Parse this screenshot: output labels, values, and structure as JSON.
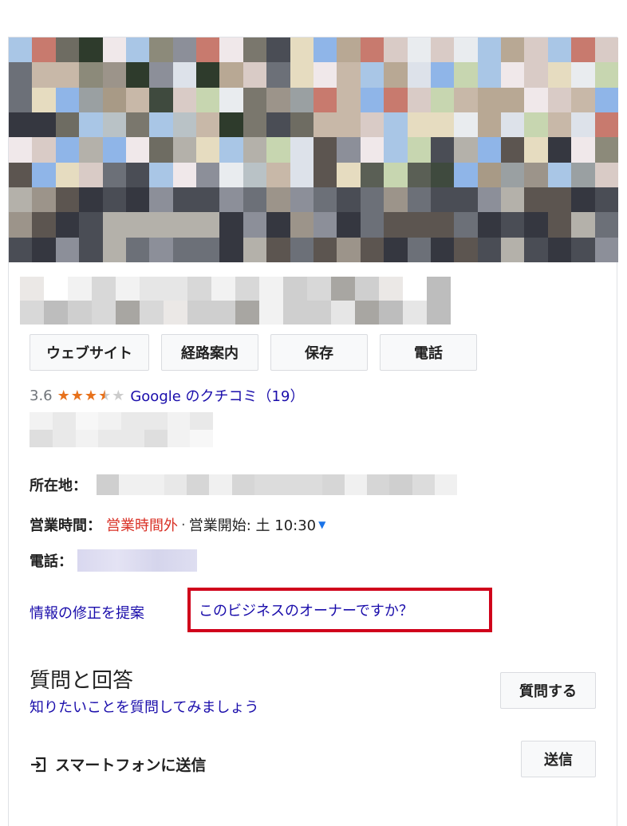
{
  "actions": {
    "website": "ウェブサイト",
    "directions": "経路案内",
    "save": "保存",
    "call": "電話"
  },
  "rating": {
    "value": "3.6",
    "stars_filled": 3.5,
    "stars_total": 5,
    "reviews_label": "Google のクチコミ（19）"
  },
  "info": {
    "address_label": "所在地：",
    "hours_label": "営業時間：",
    "hours_status": "営業時間外",
    "separator": "·",
    "hours_next": "営業開始: 土 10:30",
    "phone_label": "電話："
  },
  "links": {
    "suggest_edit": "情報の修正を提案",
    "own_business": "このビジネスのオーナーですか？"
  },
  "qa": {
    "title": "質問と回答",
    "subtitle": "知りたいことを質問してみましょう",
    "ask_button": "質問する"
  },
  "send": {
    "label": "スマートフォンに送信",
    "button": "送信"
  },
  "colors": {
    "link": "#1a0dab",
    "closed_red": "#d93025",
    "star": "#e7711b",
    "highlight_box": "#d0021b"
  }
}
